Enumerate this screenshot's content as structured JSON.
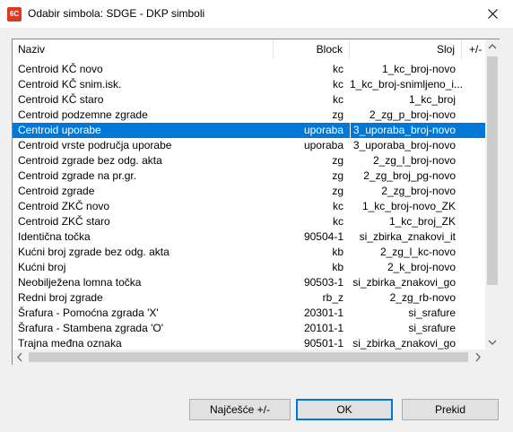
{
  "window": {
    "title": "Odabir simbola: SDGE - DKP simboli",
    "app_icon_text": "6C"
  },
  "columns": {
    "naziv": "Naziv",
    "block": "Block",
    "sloj": "Sloj",
    "plus": "+/-"
  },
  "rows": [
    {
      "name": "Centroid KČ novo",
      "block": "kc",
      "sloj": "1_kc_broj-novo"
    },
    {
      "name": "Centroid KČ snim.isk.",
      "block": "kc",
      "sloj": "1_kc_broj-snimljeno_i..."
    },
    {
      "name": "Centroid KČ staro",
      "block": "kc",
      "sloj": "1_kc_broj"
    },
    {
      "name": "Centroid podzemne zgrade",
      "block": "zg",
      "sloj": "2_zg_p_broj-novo"
    },
    {
      "name": "Centroid uporabe",
      "block": "uporaba",
      "sloj": "3_uporaba_broj-novo"
    },
    {
      "name": "Centroid vrste područja uporabe",
      "block": "uporaba",
      "sloj": "3_uporaba_broj-novo"
    },
    {
      "name": "Centroid zgrade bez odg. akta",
      "block": "zg",
      "sloj": "2_zg_l_broj-novo"
    },
    {
      "name": "Centroid zgrade na pr.gr.",
      "block": "zg",
      "sloj": "2_zg_broj_pg-novo"
    },
    {
      "name": "Centroid zgrade",
      "block": "zg",
      "sloj": "2_zg_broj-novo"
    },
    {
      "name": "Centroid ZKČ novo",
      "block": "kc",
      "sloj": "1_kc_broj-novo_ZK"
    },
    {
      "name": "Centroid ZKČ staro",
      "block": "kc",
      "sloj": "1_kc_broj_ZK"
    },
    {
      "name": "Identična točka",
      "block": "90504-1",
      "sloj": "si_zbirka_znakovi_it"
    },
    {
      "name": "Kućni broj zgrade bez odg. akta",
      "block": "kb",
      "sloj": "2_zg_l_kc-novo"
    },
    {
      "name": "Kućni broj",
      "block": "kb",
      "sloj": "2_k_broj-novo"
    },
    {
      "name": "Neobilježena lomna točka",
      "block": "90503-1",
      "sloj": "si_zbirka_znakovi_go"
    },
    {
      "name": "Redni broj zgrade",
      "block": "rb_z",
      "sloj": "2_zg_rb-novo"
    },
    {
      "name": "Šrafura - Pomoćna zgrada 'X'",
      "block": "20301-1",
      "sloj": "si_srafure"
    },
    {
      "name": "Šrafura - Stambena zgrada 'O'",
      "block": "20101-1",
      "sloj": "si_srafure"
    },
    {
      "name": "Trajna međna oznaka",
      "block": "90501-1",
      "sloj": "si_zbirka_znakovi_go"
    }
  ],
  "selected_row_index": 4,
  "buttons": {
    "najcesce": "Najčešće +/-",
    "ok": "OK",
    "prekid": "Prekid"
  },
  "colors": {
    "selection": "#0078d7",
    "app_icon": "#e2361f"
  }
}
